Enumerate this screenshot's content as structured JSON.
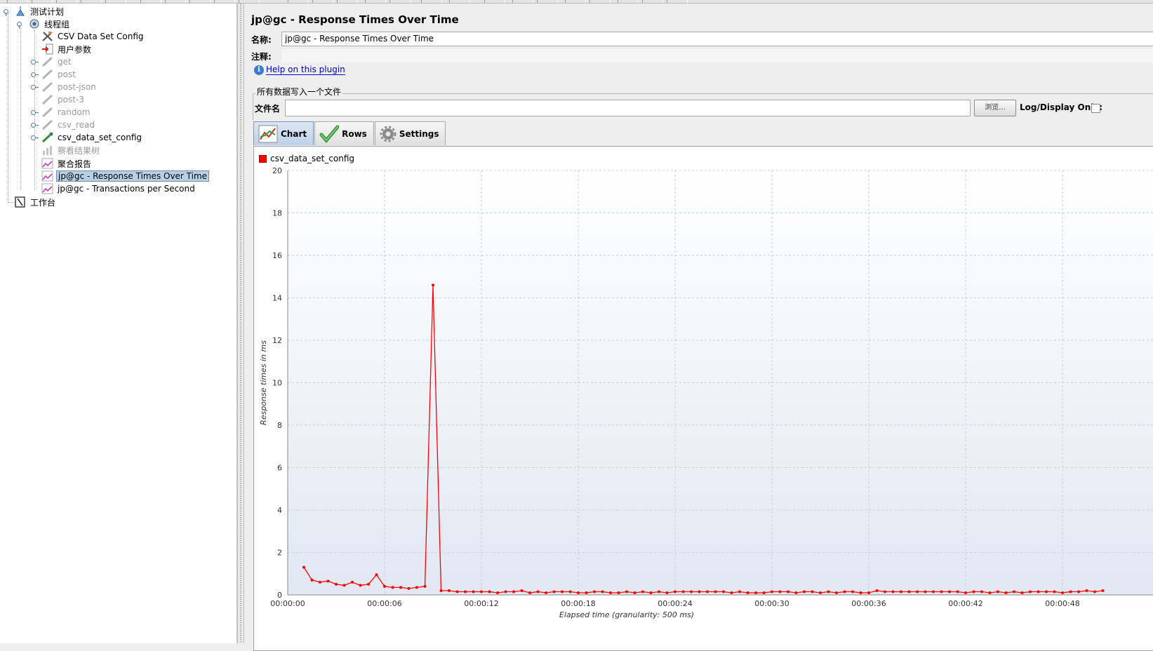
{
  "tree": {
    "items": [
      {
        "label": "测试计划",
        "icon": "test-plan-icon"
      },
      {
        "label": "线程组",
        "icon": "thread-group-icon"
      },
      {
        "label": "CSV Data Set Config",
        "icon": "config-tools-icon"
      },
      {
        "label": "用户参数",
        "icon": "user-parameters-icon"
      },
      {
        "label": "get",
        "icon": "sampler-icon"
      },
      {
        "label": "post",
        "icon": "sampler-icon"
      },
      {
        "label": "post-json",
        "icon": "sampler-icon"
      },
      {
        "label": "post-3",
        "icon": "sampler-icon"
      },
      {
        "label": "random",
        "icon": "sampler-icon"
      },
      {
        "label": "csv_read",
        "icon": "sampler-icon"
      },
      {
        "label": "csv_data_set_config",
        "icon": "sampler-icon"
      },
      {
        "label": "察看结果树",
        "icon": "listener-icon"
      },
      {
        "label": "聚合报告",
        "icon": "graph-icon"
      },
      {
        "label": "jp@gc - Response Times Over Time",
        "icon": "graph-icon"
      },
      {
        "label": "jp@gc - Transactions per Second",
        "icon": "graph-icon"
      },
      {
        "label": "工作台",
        "icon": "workbench-icon"
      }
    ]
  },
  "panel": {
    "title": "jp@gc - Response Times Over Time",
    "name_label": "名称:",
    "name_value": "jp@gc - Response Times Over Time",
    "comment_label": "注释:",
    "comment_value": "",
    "help_link": "Help on this plugin",
    "group_title": "所有数据写入一个文件",
    "filename_label": "文件名",
    "filename_value": "",
    "browse_label": "浏览...",
    "log_display_label": "Log/Display Only:",
    "log_display_checked": false
  },
  "tabs": [
    {
      "label": "Chart",
      "icon": "chart-icon",
      "active": true
    },
    {
      "label": "Rows",
      "icon": "checkmark-icon",
      "active": false
    },
    {
      "label": "Settings",
      "icon": "gear-icon",
      "active": false
    }
  ],
  "colors": {
    "series": "#ff0000",
    "selection": "#b8cfe5",
    "link": "#0000d0"
  },
  "chart_data": {
    "type": "line",
    "title": "",
    "xlabel": "Elapsed time (granularity: 500 ms)",
    "ylabel": "Response times in ms",
    "ylim": [
      0,
      20
    ],
    "xlim_seconds": [
      0,
      50.5
    ],
    "y_ticks": [
      "0",
      "2",
      "4",
      "6",
      "8",
      "10",
      "12",
      "14",
      "16",
      "18",
      "20"
    ],
    "x_ticks": [
      "00:00:00",
      "00:00:06",
      "00:00:12",
      "00:00:18",
      "00:00:24",
      "00:00:30",
      "00:00:36",
      "00:00:42",
      "00:00:48"
    ],
    "grid": true,
    "legend": "top-left",
    "series": [
      {
        "name": "csv_data_set_config",
        "x_seconds": [
          1,
          1.5,
          2,
          2.5,
          3,
          3.5,
          4,
          4.5,
          5,
          5.5,
          6,
          6.5,
          7,
          7.5,
          8,
          8.5,
          9,
          9.5,
          10,
          10.5,
          11,
          11.5,
          12,
          12.5,
          13,
          13.5,
          14,
          14.5,
          15,
          15.5,
          16,
          16.5,
          17,
          17.5,
          18,
          18.5,
          19,
          19.5,
          20,
          20.5,
          21,
          21.5,
          22,
          22.5,
          23,
          23.5,
          24,
          24.5,
          25,
          25.5,
          26,
          26.5,
          27,
          27.5,
          28,
          28.5,
          29,
          29.5,
          30,
          30.5,
          31,
          31.5,
          32,
          32.5,
          33,
          33.5,
          34,
          34.5,
          35,
          35.5,
          36,
          36.5,
          37,
          37.5,
          38,
          38.5,
          39,
          39.5,
          40,
          40.5,
          41,
          41.5,
          42,
          42.5,
          43,
          43.5,
          44,
          44.5,
          45,
          45.5,
          46,
          46.5,
          47,
          47.5,
          48,
          48.5,
          49,
          49.5,
          50,
          50.5
        ],
        "values": [
          1.3,
          0.7,
          0.6,
          0.65,
          0.5,
          0.45,
          0.6,
          0.45,
          0.5,
          0.95,
          0.4,
          0.35,
          0.35,
          0.3,
          0.35,
          0.4,
          14.6,
          0.2,
          0.2,
          0.15,
          0.15,
          0.15,
          0.15,
          0.15,
          0.1,
          0.15,
          0.15,
          0.2,
          0.1,
          0.15,
          0.1,
          0.15,
          0.15,
          0.15,
          0.1,
          0.1,
          0.15,
          0.15,
          0.1,
          0.1,
          0.15,
          0.1,
          0.15,
          0.1,
          0.15,
          0.1,
          0.15,
          0.15,
          0.15,
          0.15,
          0.15,
          0.15,
          0.15,
          0.1,
          0.15,
          0.1,
          0.1,
          0.1,
          0.15,
          0.15,
          0.15,
          0.1,
          0.15,
          0.15,
          0.1,
          0.15,
          0.1,
          0.15,
          0.15,
          0.1,
          0.1,
          0.2,
          0.15,
          0.15,
          0.15,
          0.15,
          0.15,
          0.15,
          0.15,
          0.15,
          0.15,
          0.15,
          0.1,
          0.15,
          0.15,
          0.1,
          0.15,
          0.1,
          0.15,
          0.1,
          0.15,
          0.15,
          0.15,
          0.15,
          0.1,
          0.15,
          0.15,
          0.2,
          0.15,
          0.2
        ]
      }
    ]
  }
}
